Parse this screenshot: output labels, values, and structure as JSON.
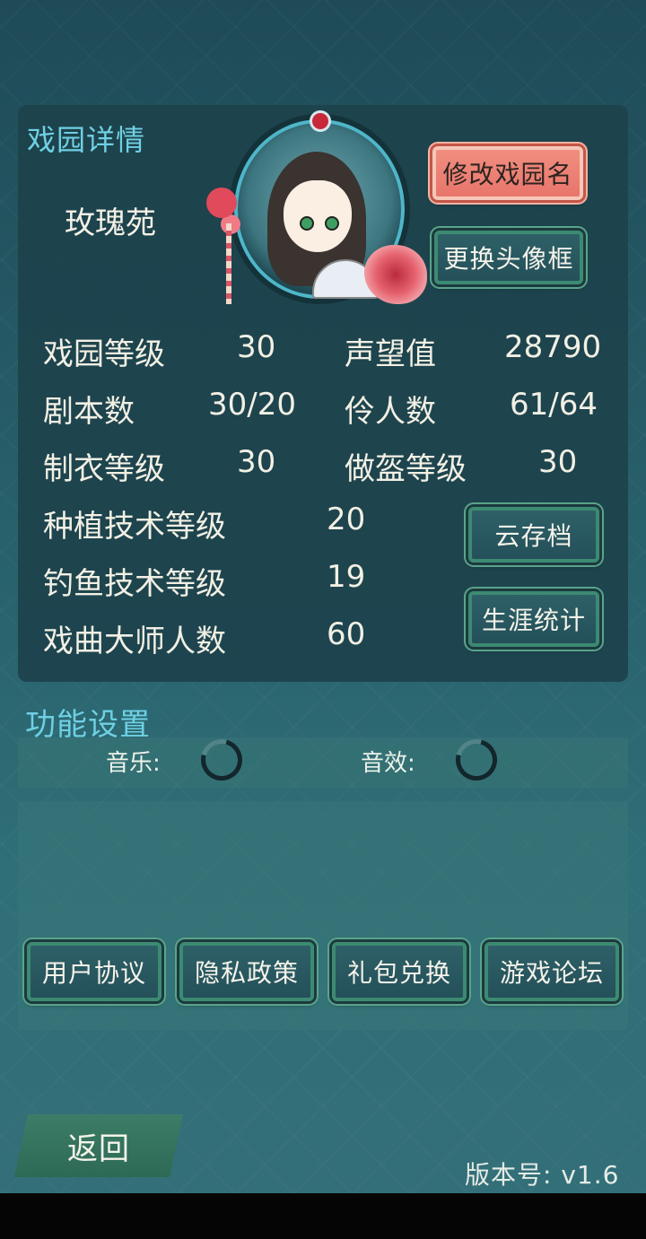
{
  "panel": {
    "title": "戏园详情",
    "garden_name": "玫瑰苑",
    "rename_button": "修改戏园名",
    "change_frame_button": "更换头像框"
  },
  "stats": {
    "garden_level": {
      "label": "戏园等级",
      "value": "30"
    },
    "reputation": {
      "label": "声望值",
      "value": "28790"
    },
    "scripts": {
      "label": "剧本数",
      "value": "30/20"
    },
    "actors": {
      "label": "伶人数",
      "value": "61/64"
    },
    "costume_level": {
      "label": "制衣等级",
      "value": "30"
    },
    "helmet_level": {
      "label": "做盔等级",
      "value": "30"
    },
    "planting_level": {
      "label": "种植技术等级",
      "value": "20"
    },
    "fishing_level": {
      "label": "钓鱼技术等级",
      "value": "19"
    },
    "master_count": {
      "label": "戏曲大师人数",
      "value": "60"
    }
  },
  "side_buttons": {
    "cloud_save": "云存档",
    "career_stats": "生涯统计"
  },
  "settings": {
    "title": "功能设置",
    "music_label": "音乐:",
    "sfx_label": "音效:"
  },
  "links": [
    "用户协议",
    "隐私政策",
    "礼包兑换",
    "游戏论坛"
  ],
  "back_button": "返回",
  "version": "版本号: v1.6"
}
